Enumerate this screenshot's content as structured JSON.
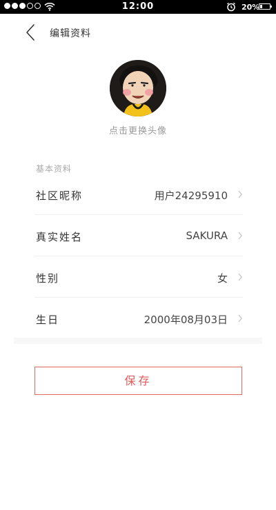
{
  "status_bar": {
    "time": "12:00",
    "battery_text": "20%",
    "battery_level": 0.2,
    "signal_bars_filled": 3,
    "signal_bars_total": 5
  },
  "header": {
    "title": "编辑资料"
  },
  "avatar": {
    "hint": "点击更换头像"
  },
  "basic_info": {
    "section_label": "基本资料",
    "rows": [
      {
        "label": "社区昵称",
        "value": "用户24295910"
      },
      {
        "label": "真实姓名",
        "value": "SAKURA"
      },
      {
        "label": "性别",
        "value": "女"
      },
      {
        "label": "生日",
        "value": "2000年08月03日"
      }
    ]
  },
  "save_button": {
    "label": "保存"
  },
  "colors": {
    "accent": "#e05a5a",
    "status_bar_bg": "#000000"
  }
}
